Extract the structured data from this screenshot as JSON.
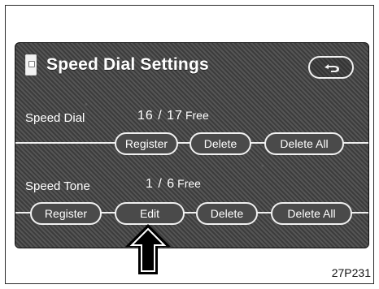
{
  "title": "Speed Dial Settings",
  "rows": [
    {
      "label": "Speed Dial",
      "value": "16 / 17",
      "free": "Free",
      "buttons": [
        "Register",
        "Delete",
        "Delete All"
      ]
    },
    {
      "label": "Speed Tone",
      "value": "1 /   6",
      "free": "Free",
      "buttons": [
        "Register",
        "Edit",
        "Delete",
        "Delete All"
      ]
    }
  ],
  "caption": "27P231",
  "icons": {
    "phone": "phone-icon",
    "back": "back-icon",
    "pointer": "arrow-icon"
  }
}
